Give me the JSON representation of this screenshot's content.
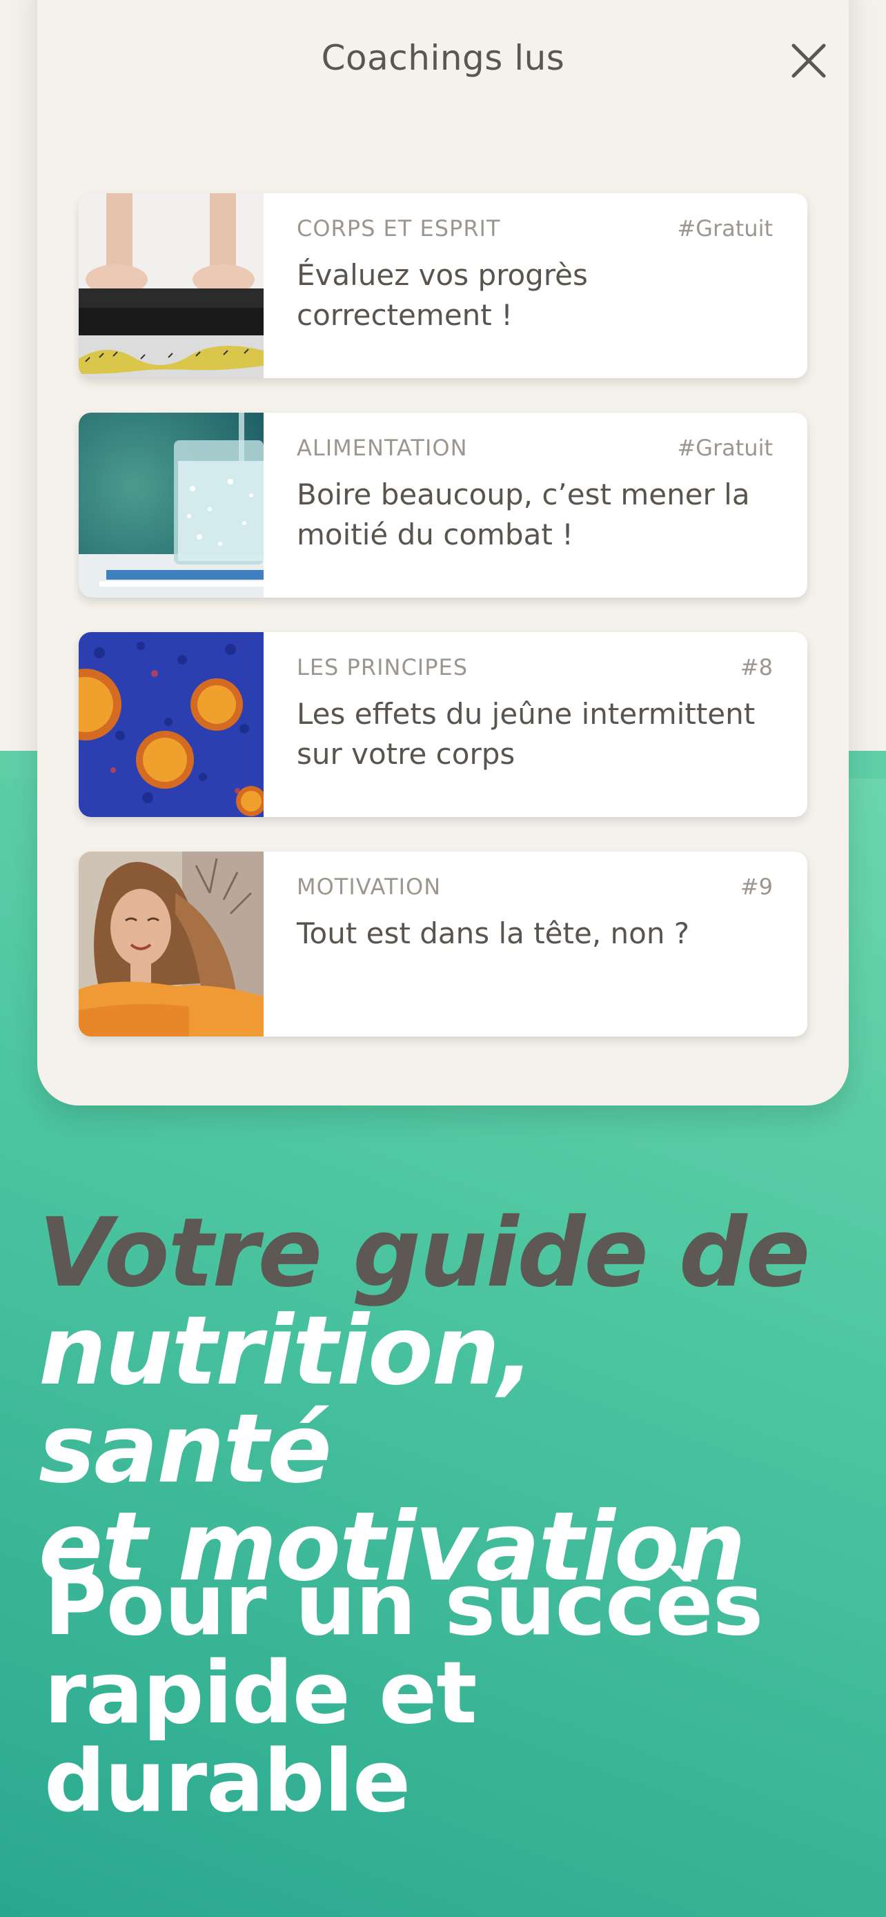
{
  "sheet": {
    "title": "Coachings lus",
    "close_icon": "close-icon"
  },
  "cards": [
    {
      "category": "CORPS ET ESPRIT",
      "tag": "#Gratuit",
      "title": "Évaluez vos progrès correctement !",
      "image": "feet-on-scale-with-measuring-tape"
    },
    {
      "category": "ALIMENTATION",
      "tag": "#Gratuit",
      "title": "Boire beaucoup, c’est mener la moitié du combat !",
      "image": "glass-of-sparkling-water"
    },
    {
      "category": "LES PRINCIPES",
      "tag": "#8",
      "title": "Les effets du jeûne intermittent sur votre corps",
      "image": "cells-microscope"
    },
    {
      "category": "MOTIVATION",
      "tag": "#9",
      "title": "Tout est dans la tête, non ?",
      "image": "smiling-woman-portrait"
    }
  ],
  "headline": {
    "line1": "Votre guide de",
    "line2": "nutrition, santé",
    "line3": "et motivation"
  },
  "subline": {
    "line1": "Pour un succès",
    "line2": "rapide et durable"
  },
  "colors": {
    "accent_green": "#4fc7a1",
    "sheet_bg": "#f5f1eb",
    "text_dark": "#5d5853"
  }
}
